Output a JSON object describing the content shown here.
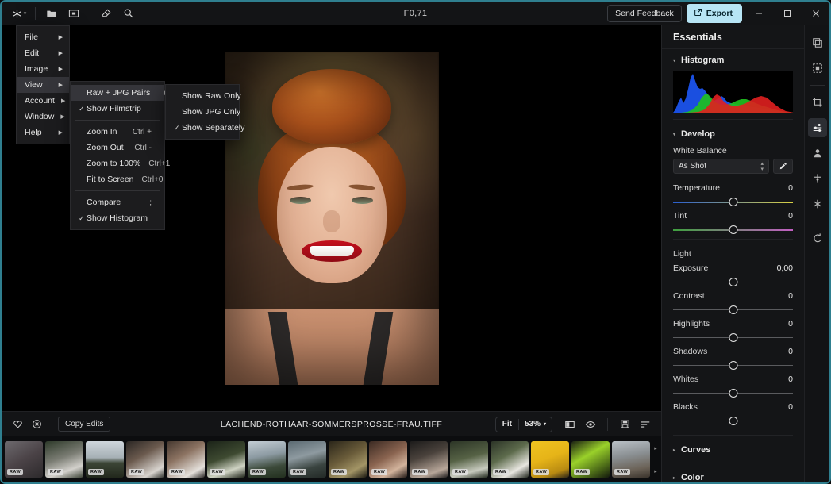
{
  "titlebar": {
    "title": "F0,71",
    "tools": [
      {
        "name": "app-logo-icon",
        "icon": "asterisk"
      },
      {
        "name": "folder-icon",
        "icon": "folder"
      },
      {
        "name": "import-icon",
        "icon": "import"
      },
      {
        "name": "eraser-icon",
        "icon": "eraser"
      },
      {
        "name": "zoom-icon",
        "icon": "magnifier"
      }
    ],
    "send_feedback": "Send Feedback",
    "export": "Export",
    "minimize": "—",
    "maximize": "□",
    "close": "✕"
  },
  "menus": {
    "main": {
      "items": [
        {
          "label": "File",
          "arrow": "▶",
          "active": false
        },
        {
          "label": "Edit",
          "arrow": "▶",
          "active": false
        },
        {
          "label": "Image",
          "arrow": "▶",
          "active": false
        },
        {
          "label": "View",
          "arrow": "▶",
          "active": true
        },
        {
          "label": "Account",
          "arrow": "▶",
          "active": false
        },
        {
          "label": "Window",
          "arrow": "▶",
          "active": false
        },
        {
          "label": "Help",
          "arrow": "▶",
          "active": false
        }
      ]
    },
    "view": {
      "items": [
        {
          "check": "",
          "label": "Raw + JPG Pairs",
          "accel": "",
          "arrow": "▶",
          "active": true,
          "sep": false
        },
        {
          "check": "✓",
          "label": "Show Filmstrip",
          "accel": "",
          "arrow": "",
          "active": false,
          "sep": false
        },
        {
          "sep": true
        },
        {
          "check": "",
          "label": "Zoom In",
          "accel": "Ctrl +",
          "arrow": "",
          "active": false,
          "sep": false
        },
        {
          "check": "",
          "label": "Zoom Out",
          "accel": "Ctrl -",
          "arrow": "",
          "active": false,
          "sep": false
        },
        {
          "check": "",
          "label": "Zoom to 100%",
          "accel": "Ctrl+1",
          "arrow": "",
          "active": false,
          "sep": false
        },
        {
          "check": "",
          "label": "Fit to Screen",
          "accel": "Ctrl+0",
          "arrow": "",
          "active": false,
          "sep": false
        },
        {
          "sep": true
        },
        {
          "check": "",
          "label": "Compare",
          "accel": ";",
          "arrow": "",
          "active": false,
          "sep": false
        },
        {
          "check": "✓",
          "label": "Show Histogram",
          "accel": "",
          "arrow": "",
          "active": false,
          "sep": false
        }
      ]
    },
    "pairs": {
      "items": [
        {
          "check": "",
          "label": "Show Raw Only"
        },
        {
          "check": "",
          "label": "Show JPG Only"
        },
        {
          "check": "✓",
          "label": "Show Separately"
        }
      ]
    }
  },
  "right_panel": {
    "header": "Essentials",
    "histogram": {
      "title": "Histogram",
      "triangle": "▾"
    },
    "develop": {
      "title": "Develop",
      "triangle": "▾",
      "white_balance_label": "White Balance",
      "white_balance_value": "As Shot",
      "eyedropper_name": "eyedropper-icon",
      "sliders": [
        {
          "label": "Temperature",
          "value": "0",
          "track": "temp",
          "pos": 50
        },
        {
          "label": "Tint",
          "value": "0",
          "track": "tint",
          "pos": 50
        }
      ],
      "light_label": "Light",
      "light_sliders": [
        {
          "label": "Exposure",
          "value": "0,00",
          "pos": 50
        },
        {
          "label": "Contrast",
          "value": "0",
          "pos": 50
        },
        {
          "label": "Highlights",
          "value": "0",
          "pos": 50
        },
        {
          "label": "Shadows",
          "value": "0",
          "pos": 50
        },
        {
          "label": "Whites",
          "value": "0",
          "pos": 50
        },
        {
          "label": "Blacks",
          "value": "0",
          "pos": 50
        }
      ]
    },
    "curves": {
      "title": "Curves",
      "triangle": "▸"
    },
    "color": {
      "title": "Color",
      "triangle": "▸"
    }
  },
  "rail": {
    "items": [
      {
        "name": "layers-icon",
        "sel": false
      },
      {
        "name": "select-subject-icon",
        "sel": false
      },
      {
        "name": "crop-icon",
        "sel": false
      },
      {
        "name": "adjustments-icon",
        "sel": true
      },
      {
        "name": "portrait-icon",
        "sel": false
      },
      {
        "name": "retouch-icon",
        "sel": false
      },
      {
        "name": "effects-icon",
        "sel": false
      },
      {
        "name": "reset-icon",
        "sel": false
      }
    ]
  },
  "bottom_bar": {
    "heart_icon": "heart-icon",
    "reject_icon": "reject-icon",
    "copy_edits": "Copy Edits",
    "filename": "LACHEND-ROTHAAR-SOMMERSPROSSE-FRAU.TIFF",
    "fit_label": "Fit",
    "zoom_level": "53%",
    "zoom_caret": "▾",
    "icons": [
      {
        "name": "compare-split-icon"
      },
      {
        "name": "before-after-eye-icon"
      },
      {
        "name": "save-icon"
      },
      {
        "name": "sort-icon"
      }
    ]
  },
  "filmstrip": {
    "badge": "RAW",
    "scroll_up": "▸",
    "scroll_down": "▸",
    "thumbnails": [
      {
        "name": "thumb-1",
        "selected": false,
        "css": "linear-gradient(150deg,#6d6a6e,#4b4347 50%,#2d2a2c)"
      },
      {
        "name": "thumb-2",
        "selected": false,
        "css": "linear-gradient(160deg,#2e3a2a,#7b7d74 45%,#d3d1cc 75%,#3c4336)"
      },
      {
        "name": "thumb-3",
        "selected": false,
        "css": "linear-gradient(180deg,#cfd6dc 0%,#a6b0b5 45%,#3c4536 60%,#22281c)"
      },
      {
        "name": "thumb-4",
        "selected": false,
        "css": "linear-gradient(150deg,#2b2724,#6b5a4e 40%,#d8d4cf 80%,#31332e)"
      },
      {
        "name": "thumb-5",
        "selected": false,
        "css": "linear-gradient(150deg,#45382f,#8c7362 40%,#e4e0db 80%,#2c2a28)"
      },
      {
        "name": "thumb-6",
        "selected": false,
        "css": "linear-gradient(160deg,#1b2318,#3e4a31 45%,#cfd3c4 75%,#1d2318)"
      },
      {
        "name": "thumb-7",
        "selected": false,
        "css": "linear-gradient(170deg,#c3cdd4,#8c9aa2 40%,#3c4a3a 70%,#23301f)"
      },
      {
        "name": "thumb-8",
        "selected": false,
        "css": "linear-gradient(165deg,#5b6a72,#8e9aa0 40%,#3a4440 70%,#232a27)"
      },
      {
        "name": "thumb-9",
        "selected": false,
        "css": "linear-gradient(150deg,#2a2519,#6a5c3a 45%,#a39566 75%,#1c1a12)"
      },
      {
        "name": "thumb-10",
        "selected": false,
        "css": "linear-gradient(150deg,#3b2a22,#8a6450 45%,#d2b39c 75%,#241a16)"
      },
      {
        "name": "thumb-11",
        "selected": false,
        "css": "linear-gradient(160deg,#1c1b1a,#4a423c 40%,#b8a79a 80%,#232020)"
      },
      {
        "name": "thumb-12",
        "selected": false,
        "css": "linear-gradient(165deg,#2c3526,#566245 45%,#c8cbbf 78%,#232a1e)"
      },
      {
        "name": "thumb-13",
        "selected": false,
        "css": "linear-gradient(150deg,#2b3326,#5d6b4c 40%,#e8e6e0 75%,#262b21)"
      },
      {
        "name": "thumb-14",
        "selected": false,
        "css": "linear-gradient(160deg,#efc321,#e6b418 45%,#b98b12 80%,#2b2517)"
      },
      {
        "name": "thumb-15",
        "selected": false,
        "css": "linear-gradient(150deg,#1c2212,#9ad12a 40%,#4c6a18 75%,#141a0d)"
      },
      {
        "name": "thumb-16",
        "selected": false,
        "css": "linear-gradient(170deg,#b9c0c6,#8a8f92 40%,#6b6257 75%,#3a332c)"
      },
      {
        "name": "thumb-17",
        "selected": false,
        "css": "linear-gradient(160deg,#dcdcd8,#9fa4a8 40%,#5d6a78 75%,#35302b)"
      },
      {
        "name": "thumb-18",
        "selected": false,
        "css": "linear-gradient(180deg,#b9c6d2,#8fa2b3 45%,#6a5f52 75%,#3b352e)"
      },
      {
        "name": "thumb-19",
        "selected": false,
        "css": "linear-gradient(150deg,#cfd6da,#a8b3bb 40%,#e0ccbd 75%,#6b5c50)"
      },
      {
        "name": "thumb-20",
        "selected": false,
        "css": "linear-gradient(150deg,#b7c2ca,#8d9aa3 45%,#d9c6b6 80%,#5a4f46)"
      }
    ]
  },
  "colors": {
    "accent": "#b7e5f5",
    "window_border": "#2f7f8f",
    "panel_bg": "#141517",
    "menu_bg": "#1c1c1e"
  }
}
